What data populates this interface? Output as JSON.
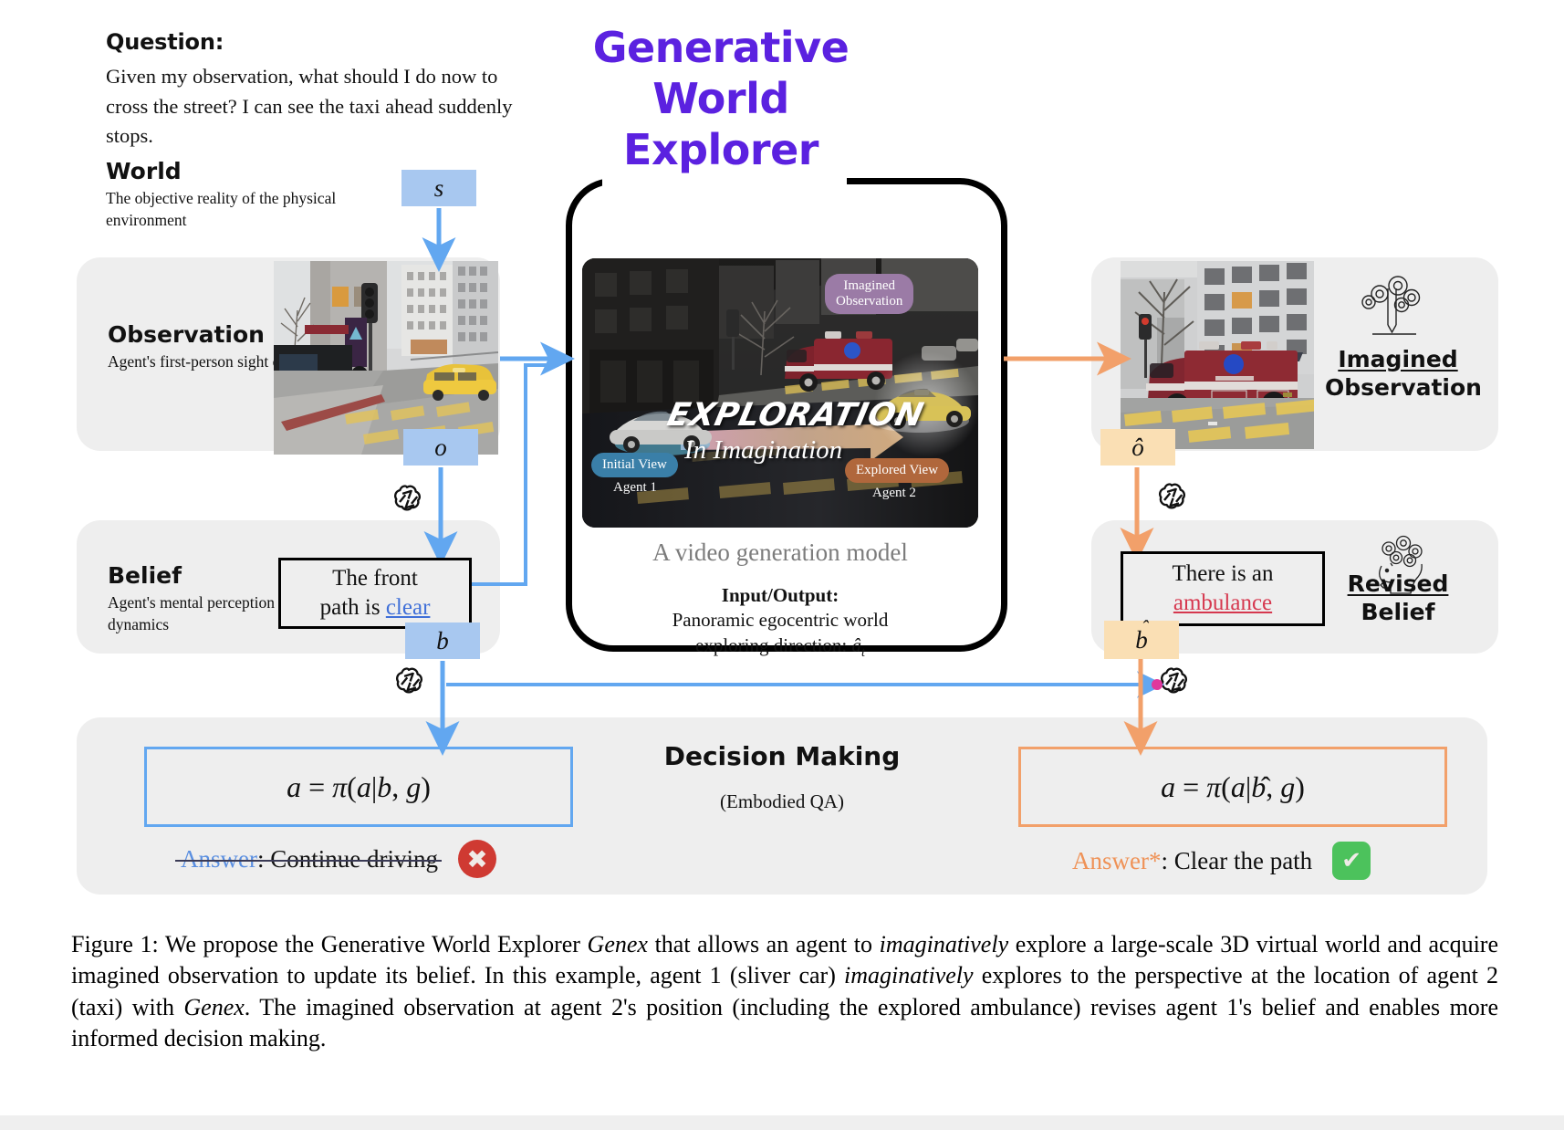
{
  "question": {
    "label": "Question:",
    "text": "Given my observation, what should I do now to cross the street? I can see the taxi ahead suddenly stops."
  },
  "rows": {
    "world": {
      "title": "World",
      "desc": "The objective reality of the physical environment"
    },
    "observation": {
      "title": "Observation",
      "desc": "Agent's first-person sight on its visible scene"
    },
    "belief": {
      "title": "Belief",
      "desc": "Agent's mental perception of surrounding dynamics"
    }
  },
  "center": {
    "title_line1": "Generative",
    "title_line2": "World",
    "title_line3": "Explorer",
    "video_caption": "A video generation  model",
    "io_title": "Input/Output:",
    "io_line1": "Panoramic egocentric world",
    "io_line2": "exploring direction: âₜ",
    "video": {
      "pill_imagined": "Imagined\nObservation",
      "pill_initial": "Initial View",
      "label_agent1": "Agent 1",
      "pill_explored": "Explored View",
      "label_agent2": "Agent 2",
      "exploration_word": "EXPLORATION",
      "exploration_sub": "In Imagination"
    }
  },
  "vars": {
    "s": "s",
    "o": "o",
    "b": "b",
    "o_hat": "ô",
    "b_hat": "b̂"
  },
  "belief_boxes": {
    "left": {
      "prefix": "The front",
      "line2_prefix": "path is ",
      "keyword": "clear"
    },
    "right": {
      "prefix": "There is an",
      "keyword": "ambulance"
    }
  },
  "right_labels": {
    "imagined_obs_line1": "Imagined",
    "imagined_obs_line2": "Observation",
    "revised_belief_line1": "Revised",
    "revised_belief_line2": "Belief"
  },
  "decision": {
    "title": "Decision Making",
    "subtitle": "(Embodied QA)",
    "formula_left": "a = π(a|b, g)",
    "formula_right": "a = π(a|b̂, g)",
    "answer_left_keyword": "Answer",
    "answer_left_rest": ": Continue driving",
    "answer_right_keyword": "Answer*",
    "answer_right_rest": ": Clear the path",
    "badge_wrong": "✖",
    "badge_correct": "✔"
  },
  "caption": {
    "lead": "Figure 1:",
    "part1": " We propose the Generative World Explorer ",
    "em1": "Genex",
    "part2": " that allows an agent to ",
    "em2": "imaginatively",
    "part3": " explore a large-scale 3D virtual world and acquire imagined observation to update its belief. In this example, agent 1 (sliver car) ",
    "em3": "imaginatively",
    "part4": " explores to the perspective at the location of agent 2 (taxi) with ",
    "em4": "Genex",
    "part5": ". The imagined observation at agent 2's position (including the explored ambulance) revises agent 1's belief and enables more informed decision making."
  },
  "colors": {
    "title_purple": "#5b21e0",
    "arrow_blue": "#62a7f0",
    "arrow_orange": "#f2a06a",
    "panel_gray": "#eeeeee",
    "link_blue": "#3f6fd8",
    "link_red": "#d6384f",
    "badge_red": "#cf3a32",
    "badge_green": "#4cc25c"
  },
  "icons": {
    "openai_1": "openai-logo-icon",
    "openai_2": "openai-logo-icon",
    "openai_3": "openai-logo-icon",
    "imagination_pencil": "imagination-pencil-icon",
    "brain_head": "brain-head-icon"
  }
}
